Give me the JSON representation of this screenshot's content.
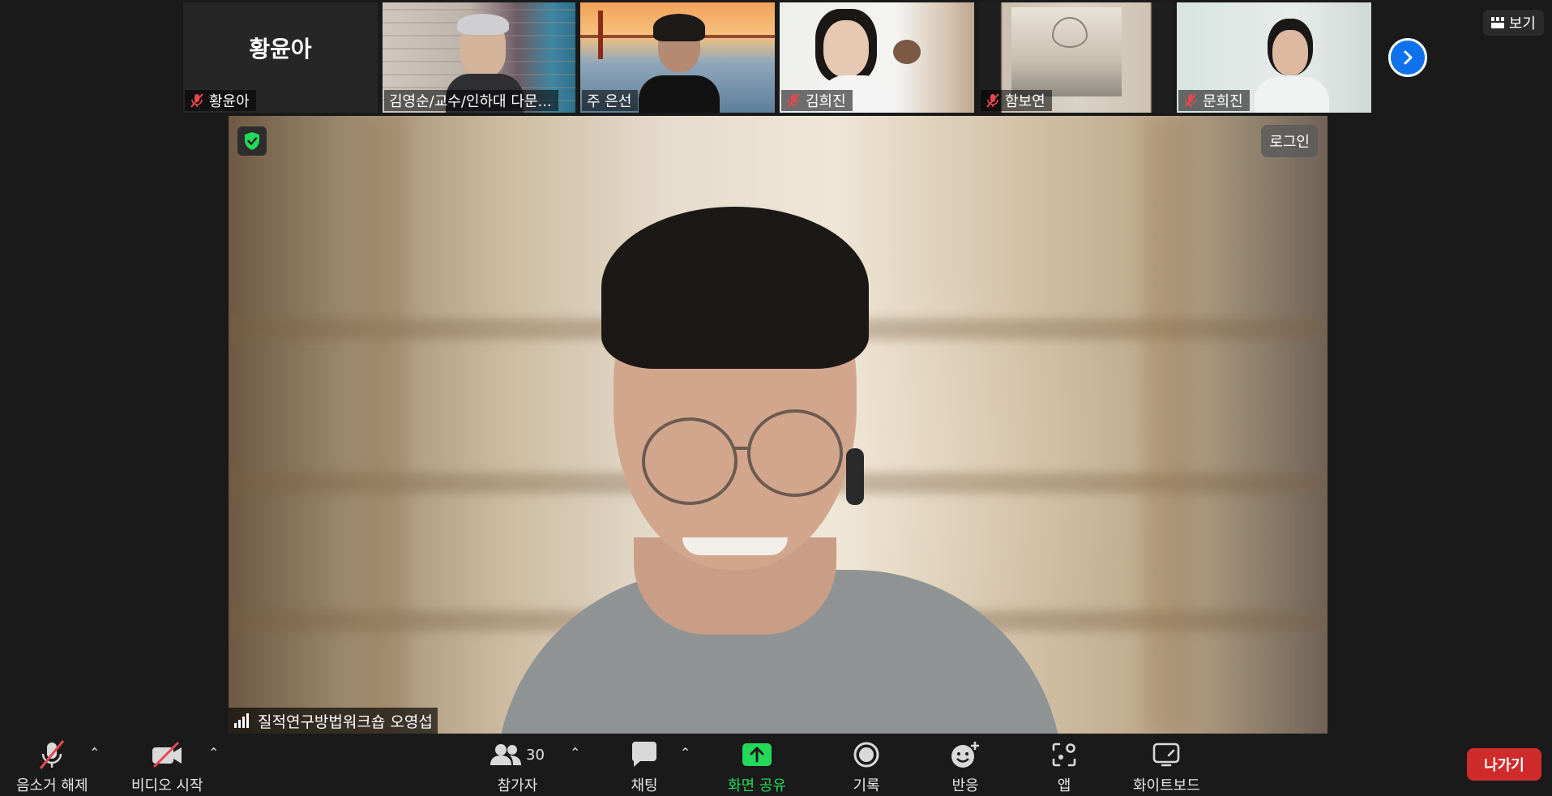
{
  "thumbnails": [
    {
      "name": "황윤아",
      "big_label": "황윤아",
      "muted": true
    },
    {
      "name": "김영순/교수/인하대 다문...",
      "muted": false
    },
    {
      "name": "주 은선",
      "muted": false
    },
    {
      "name": "김희진",
      "muted": true
    },
    {
      "name": "함보연",
      "muted": true
    },
    {
      "name": "문희진",
      "muted": true
    }
  ],
  "view_button": {
    "label": "보기",
    "icon": "grid-icon"
  },
  "next_page_icon": "chevron-right-icon",
  "main_video": {
    "speaker_name": "질적연구방법워크숍 오영섭",
    "login_label": "로그인",
    "signal_icon": "signal-bars-icon",
    "security_icon": "shield-check-icon"
  },
  "toolbar": {
    "audio": {
      "label": "음소거 해제",
      "icon": "mic-muted-icon"
    },
    "video": {
      "label": "비디오 시작",
      "icon": "camera-off-icon"
    },
    "participants": {
      "label": "참가자",
      "count": "30",
      "icon": "participants-icon"
    },
    "chat": {
      "label": "채팅",
      "icon": "chat-icon"
    },
    "share": {
      "label": "화면 공유",
      "icon": "share-screen-icon"
    },
    "record": {
      "label": "기록",
      "icon": "record-icon"
    },
    "reactions": {
      "label": "반응",
      "icon": "reaction-icon"
    },
    "apps": {
      "label": "앱",
      "icon": "apps-icon"
    },
    "whiteboard": {
      "label": "화이트보드",
      "icon": "whiteboard-icon"
    },
    "leave": {
      "label": "나가기"
    }
  },
  "colors": {
    "accent_blue": "#0e72ed",
    "share_green": "#23d959",
    "leave_red": "#d02b2b",
    "muted_red": "#e5484d",
    "background": "#1a1a1a"
  }
}
